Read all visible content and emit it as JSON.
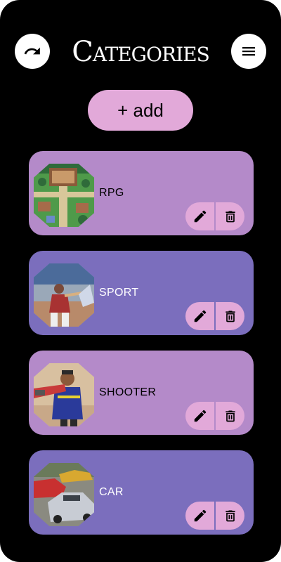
{
  "header": {
    "title": "Categories",
    "back_icon": "undo-arrow-icon",
    "menu_icon": "hamburger-menu-icon"
  },
  "add_button": {
    "label": "+ add"
  },
  "colors": {
    "background": "#000000",
    "pink": "#e2a9d9",
    "card_light": "#b48ac9",
    "card_dark": "#7b6ebd"
  },
  "categories": [
    {
      "label": "RPG",
      "image": "pixel-rpg-village-thumbnail",
      "edit_icon": "pencil-icon",
      "delete_icon": "trash-icon"
    },
    {
      "label": "SPORT",
      "image": "baseball-player-thumbnail",
      "edit_icon": "pencil-icon",
      "delete_icon": "trash-icon"
    },
    {
      "label": "SHOOTER",
      "image": "shooter-character-thumbnail",
      "edit_icon": "pencil-icon",
      "delete_icon": "trash-icon"
    },
    {
      "label": "CAR",
      "image": "sports-cars-thumbnail",
      "edit_icon": "pencil-icon",
      "delete_icon": "trash-icon"
    }
  ]
}
